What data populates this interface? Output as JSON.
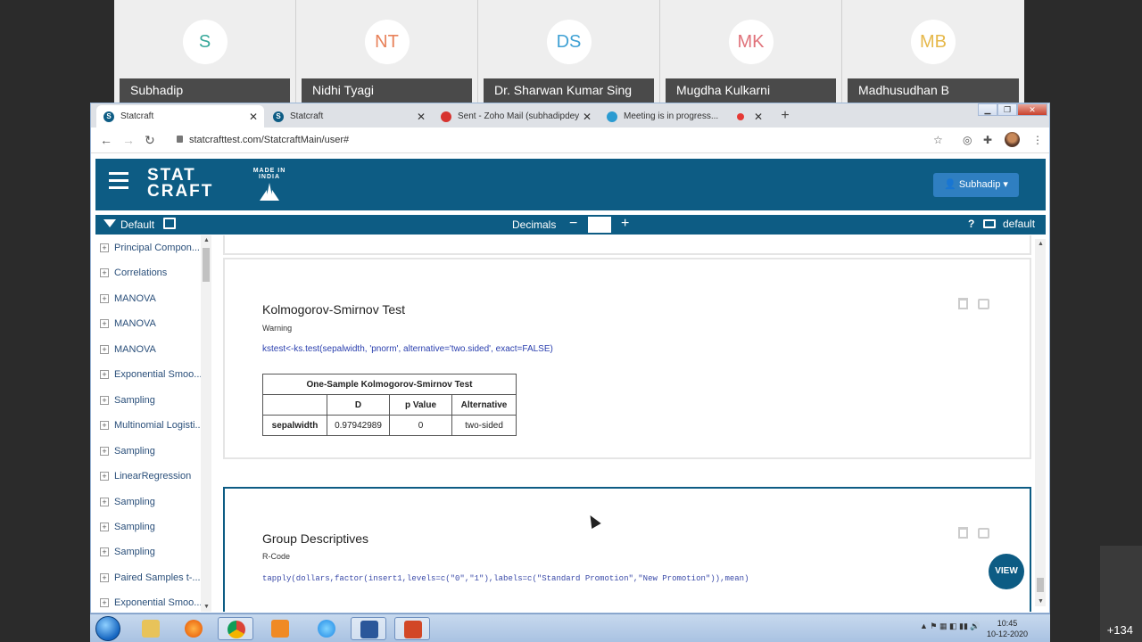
{
  "participants": [
    {
      "initials": "S",
      "name": "Subhadip",
      "color": "#37a89a"
    },
    {
      "initials": "NT",
      "name": "Nidhi Tyagi",
      "color": "#e8825a"
    },
    {
      "initials": "DS",
      "name": "Dr. Sharwan Kumar Sing",
      "color": "#3fa1d4"
    },
    {
      "initials": "MK",
      "name": "Mugdha Kulkarni",
      "color": "#e0727a"
    },
    {
      "initials": "MB",
      "name": "Madhusudhan B",
      "color": "#e6b84a"
    }
  ],
  "meeting": {
    "extra_count": "+134"
  },
  "browser": {
    "tabs": [
      {
        "label": "Statcraft",
        "icon": "statcraft-favicon"
      },
      {
        "label": "Statcraft",
        "icon": "statcraft-favicon"
      },
      {
        "label": "Sent - Zoho Mail (subhadipdey@",
        "icon": "zoho-favicon"
      },
      {
        "label": "Meeting is in progress...",
        "icon": "meeting-favicon"
      }
    ],
    "url": "statcrafttest.com/StatcraftMain/user#"
  },
  "app": {
    "logo_line1": "STAT",
    "logo_line2": "CRAFT",
    "made_in": "MADE IN INDIA",
    "user_button": "Subhadip",
    "toolbar": {
      "default_label": "Default",
      "decimals_label": "Decimals",
      "decimals_minus": "−",
      "decimals_plus": "+",
      "help": "?",
      "right_default": "default"
    },
    "brand_color": "#0d5c84"
  },
  "sidebar": {
    "items": [
      "Principal Compon...",
      "Correlations",
      "MANOVA",
      "MANOVA",
      "MANOVA",
      "Exponential Smoo...",
      "Sampling",
      "Multinomial Logisti...",
      "Sampling",
      "LinearRegression",
      "Sampling",
      "Sampling",
      "Sampling",
      "Paired Samples t-...",
      "Exponential Smoo..."
    ]
  },
  "ks_card": {
    "title": "Kolmogorov-Smirnov Test",
    "subtitle": "Warning",
    "code": "kstest<-ks.test(sepalwidth, 'pnorm', alternative='two.sided', exact=FALSE)",
    "table": {
      "caption": "One-Sample Kolmogorov-Smirnov Test",
      "headers": [
        "",
        "D",
        "p Value",
        "Alternative"
      ],
      "rows": [
        [
          "sepalwidth",
          "0.97942989",
          "0",
          "two-sided"
        ]
      ]
    }
  },
  "gd_card": {
    "title": "Group Descriptives",
    "subtitle": "R-Code",
    "code": "tapply(dollars,factor(insert1,levels=c(\"0\",\"1\"),labels=c(\"Standard Promotion\",\"New Promotion\")),mean)"
  },
  "view_button": "VIEW",
  "taskbar": {
    "time": "10:45",
    "date": "10-12-2020"
  }
}
